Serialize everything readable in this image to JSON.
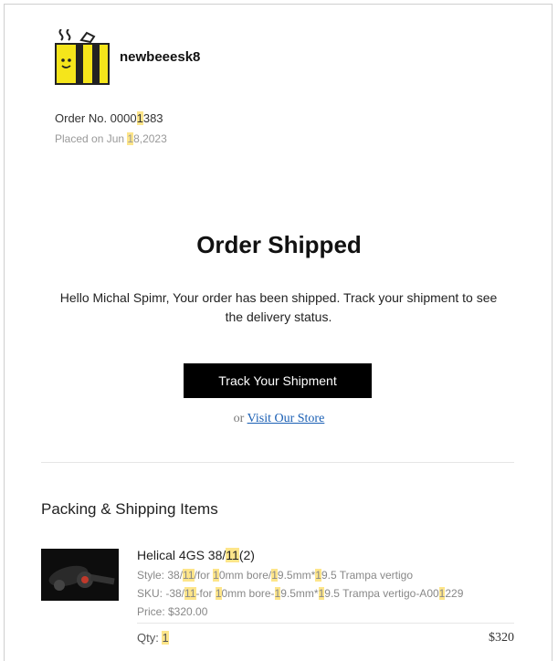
{
  "brand": {
    "name": "newbeeesk8",
    "logo_icon": "bee-stripes-logo-icon",
    "logo_color": "#f5e51b"
  },
  "order": {
    "number_prefix": "Order No. 0000",
    "number_highlight": "1",
    "number_suffix": "383",
    "placed_prefix": "Placed on Jun ",
    "placed_highlight": "1",
    "placed_suffix": "8,2023"
  },
  "hero": {
    "title": "Order Shipped",
    "message": "Hello Michal Spimr, Your order has been shipped. Track your shipment to see the delivery status.",
    "track_button": "Track Your Shipment",
    "or_text": "or",
    "store_link": "Visit Our Store"
  },
  "items_section": {
    "title": "Packing & Shipping Items",
    "items": [
      {
        "name_pre": "Helical 4GS 38/",
        "name_hl": "11",
        "name_post": "(2)",
        "style_parts": [
          "Style: 38/",
          "11",
          "/for ",
          "1",
          "0mm bore/",
          "1",
          "9.5mm*",
          "1",
          "9.5 Trampa vertigo"
        ],
        "sku_parts": [
          "SKU: -38/",
          "11",
          "-for ",
          "1",
          "0mm bore-",
          "1",
          "9.5mm*",
          "1",
          "9.5 Trampa vertigo-A00",
          "1",
          "229"
        ],
        "price": "Price: $320.00",
        "qty_label": "Qty: ",
        "qty_value": "1",
        "total": "$320"
      }
    ]
  },
  "colors": {
    "highlight": "#fde58a",
    "button_bg": "#000000",
    "link": "#1a5fb4"
  }
}
